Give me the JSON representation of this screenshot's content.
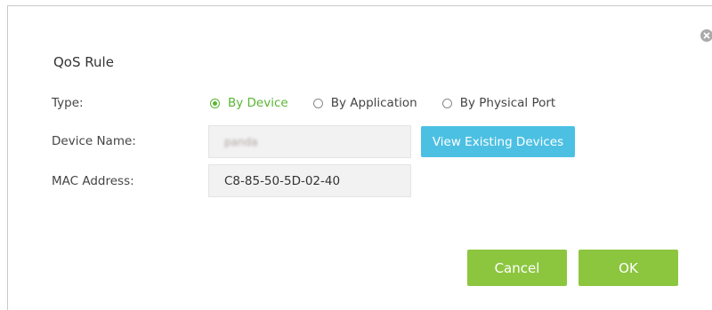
{
  "dialog": {
    "title": "QoS Rule",
    "close_icon": "close-circle-icon"
  },
  "form": {
    "type_label": "Type:",
    "type_options": [
      {
        "label": "By Device",
        "selected": true
      },
      {
        "label": "By Application",
        "selected": false
      },
      {
        "label": "By Physical Port",
        "selected": false
      }
    ],
    "device_name_label": "Device Name:",
    "device_name_value": "panda",
    "view_devices_label": "View Existing Devices",
    "mac_label": "MAC Address:",
    "mac_value": "C8-85-50-5D-02-40"
  },
  "actions": {
    "cancel_label": "Cancel",
    "ok_label": "OK"
  },
  "colors": {
    "accent_green": "#8cc63f",
    "selected_radio": "#5ab533",
    "info_blue": "#4cc0e3"
  }
}
